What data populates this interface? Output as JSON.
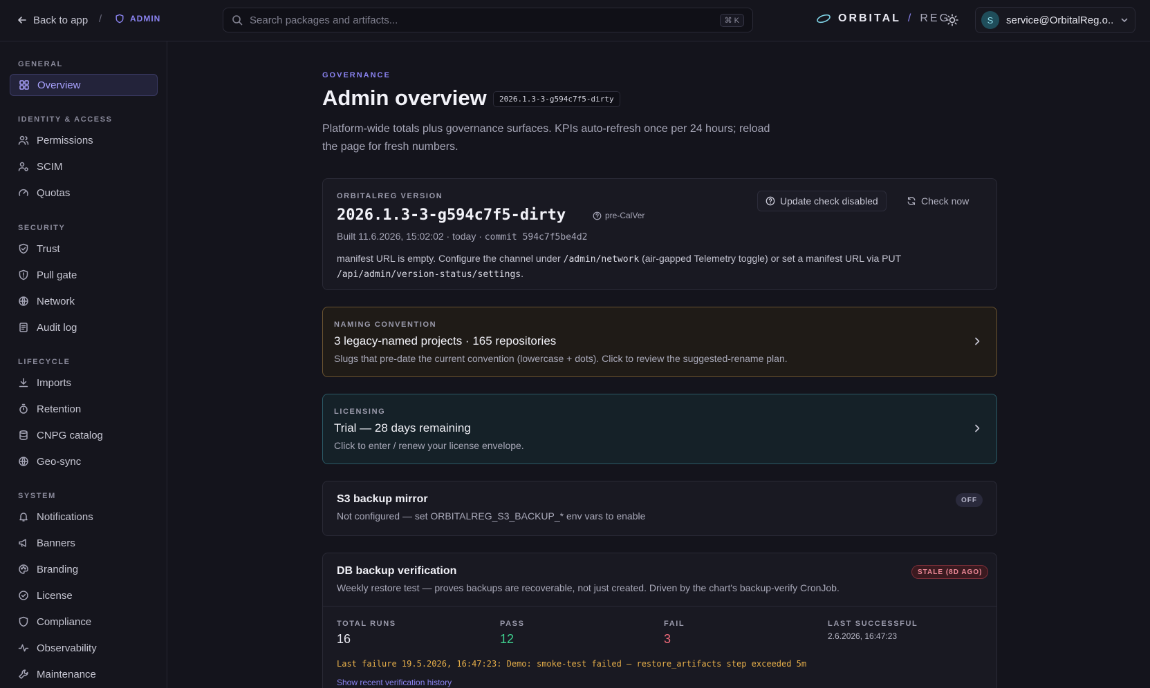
{
  "topbar": {
    "back_label": "Back to app",
    "separator": "/",
    "admin_label": "ADMIN",
    "search_placeholder": "Search packages and artifacts...",
    "search_shortcut": "⌘ K",
    "brand_main": "ORBITAL",
    "brand_slash": "/",
    "brand_suffix": "REG",
    "user_initial": "S",
    "user_email": "service@OrbitalReg.o..."
  },
  "sidebar": {
    "sections": {
      "general": "GENERAL",
      "identity": "IDENTITY & ACCESS",
      "security": "SECURITY",
      "lifecycle": "LIFECYCLE",
      "system": "SYSTEM"
    },
    "items": {
      "overview": "Overview",
      "permissions": "Permissions",
      "scim": "SCIM",
      "quotas": "Quotas",
      "trust": "Trust",
      "pull_gate": "Pull gate",
      "network": "Network",
      "audit_log": "Audit log",
      "imports": "Imports",
      "retention": "Retention",
      "cnpg_catalog": "CNPG catalog",
      "geo_sync": "Geo-sync",
      "notifications": "Notifications",
      "banners": "Banners",
      "branding": "Branding",
      "license": "License",
      "compliance": "Compliance",
      "observability": "Observability",
      "maintenance": "Maintenance"
    }
  },
  "header": {
    "eyebrow": "GOVERNANCE",
    "title": "Admin overview",
    "version_chip": "2026.1.3-3-g594c7f5-dirty",
    "description": "Platform-wide totals plus governance surfaces. KPIs auto-refresh once per 24 hours; reload the page for fresh numbers."
  },
  "version_card": {
    "eyebrow": "ORBITALREG VERSION",
    "version": "2026.1.3-3-g594c7f5-dirty",
    "precalver": "pre-CalVer",
    "built_prefix": "Built 11.6.2026, 15:02:02 · today · ",
    "commit": "commit 594c7f5be4d2",
    "manifest_1": "manifest URL is empty. Configure the channel under ",
    "manifest_code_1": "/admin/network",
    "manifest_2": " (air-gapped Telemetry toggle) or set a manifest URL via PUT",
    "manifest_code_2": "/api/admin/version-status/settings",
    "manifest_3": ".",
    "update_check_label": "Update check disabled",
    "check_now_label": "Check now"
  },
  "naming_card": {
    "eyebrow": "NAMING CONVENTION",
    "heading": "3 legacy-named projects · 165 repositories",
    "sub": "Slugs that pre-date the current convention (lowercase + dots). Click to review the suggested-rename plan."
  },
  "licensing_card": {
    "eyebrow": "LICENSING",
    "heading": "Trial — 28 days remaining",
    "sub": "Click to enter / renew your license envelope."
  },
  "s3_card": {
    "heading": "S3 backup mirror",
    "sub": "Not configured — set ORBITALREG_S3_BACKUP_* env vars to enable",
    "badge": "OFF"
  },
  "db_card": {
    "heading": "DB backup verification",
    "sub": "Weekly restore test — proves backups are recoverable, not just created. Driven by the chart's backup-verify CronJob.",
    "badge": "STALE (8D AGO)",
    "stats": {
      "total_label": "TOTAL RUNS",
      "total_value": "16",
      "pass_label": "PASS",
      "pass_value": "12",
      "fail_label": "FAIL",
      "fail_value": "3",
      "last_success_label": "LAST SUCCESSFUL",
      "last_success_value": "2.6.2026, 16:47:23"
    },
    "last_failure": "Last failure 19.5.2026, 16:47:23: Demo: smoke-test failed — restore_artifacts step exceeded 5m",
    "history_link": "Show recent verification history"
  }
}
